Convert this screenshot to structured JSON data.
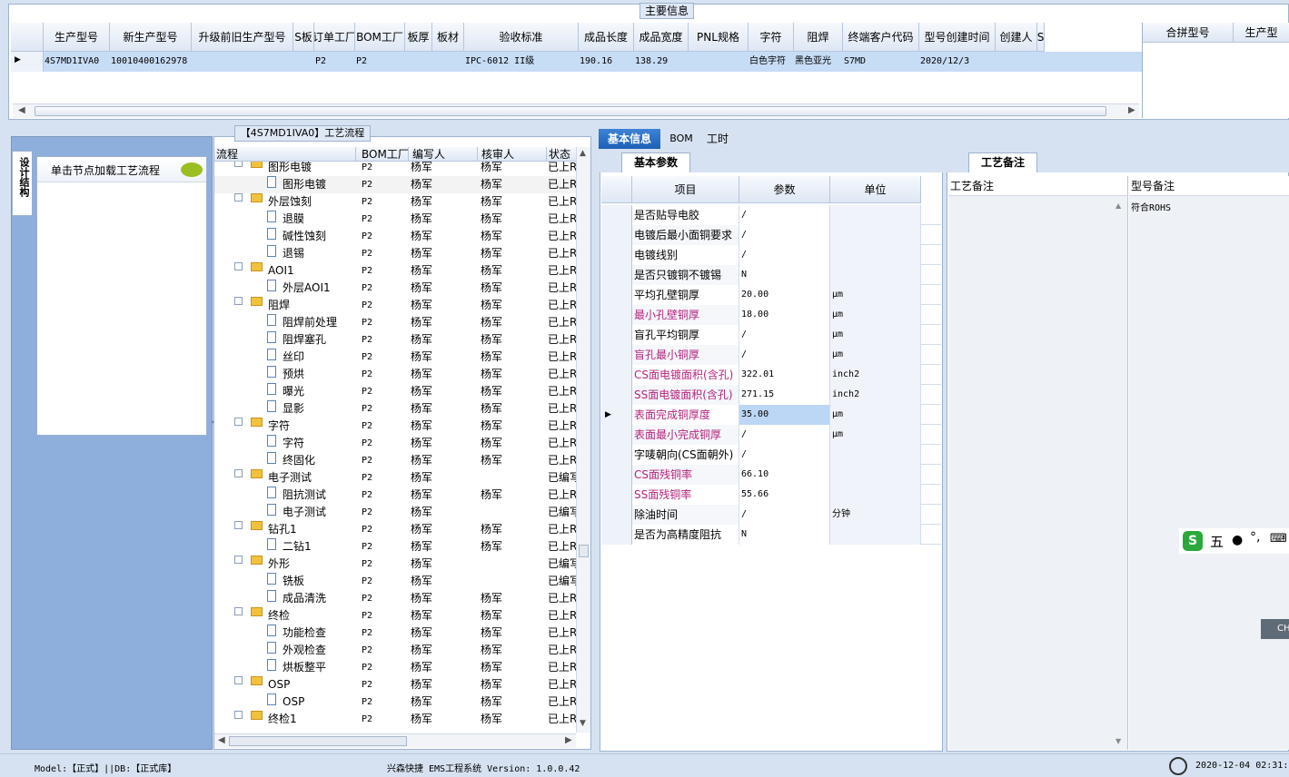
{
  "top": {
    "title": "主要信息",
    "columns": [
      "生产型号",
      "新生产型号",
      "升级前旧生产型号",
      "S板",
      "订单工厂",
      "BOM工厂",
      "板厚",
      "板材",
      "验收标准",
      "成品长度",
      "成品宽度",
      "PNL规格",
      "字符",
      "阻焊",
      "终端客户代码",
      "型号创建时间",
      "创建人",
      "S"
    ],
    "row": [
      "4S7MD1IVA0",
      "10010400162978",
      "",
      "",
      "P2",
      "P2",
      "",
      "",
      "IPC-6012 II级",
      "190.16",
      "138.29",
      "",
      "白色字符",
      "黑色亚光",
      "S7MD",
      "2020/12/3",
      "",
      ""
    ],
    "side_columns": [
      "合拼型号",
      "生产型"
    ]
  },
  "left": {
    "vertical_tab": "设计结构",
    "hint": "单击节点加载工艺流程"
  },
  "process": {
    "title": "【4S7MD1IVA0】工艺流程",
    "columns": [
      "流程",
      "BOM工厂",
      "编写人",
      "核审人",
      "状态"
    ],
    "rows": [
      {
        "name": "图形电镀",
        "folder": true,
        "f": "P2",
        "w": "杨军",
        "r": "杨军",
        "s": "已上R"
      },
      {
        "name": "图形电镀",
        "folder": false,
        "f": "P2",
        "w": "杨军",
        "r": "杨军",
        "s": "已上R"
      },
      {
        "name": "外层蚀刻",
        "folder": true,
        "f": "P2",
        "w": "杨军",
        "r": "杨军",
        "s": "已上R"
      },
      {
        "name": "退膜",
        "folder": false,
        "f": "P2",
        "w": "杨军",
        "r": "杨军",
        "s": "已上R"
      },
      {
        "name": "碱性蚀刻",
        "folder": false,
        "f": "P2",
        "w": "杨军",
        "r": "杨军",
        "s": "已上R"
      },
      {
        "name": "退锡",
        "folder": false,
        "f": "P2",
        "w": "杨军",
        "r": "杨军",
        "s": "已上R"
      },
      {
        "name": "AOI1",
        "folder": true,
        "f": "P2",
        "w": "杨军",
        "r": "杨军",
        "s": "已上R"
      },
      {
        "name": "外层AOI1",
        "folder": false,
        "f": "P2",
        "w": "杨军",
        "r": "杨军",
        "s": "已上R"
      },
      {
        "name": "阻焊",
        "folder": true,
        "f": "P2",
        "w": "杨军",
        "r": "杨军",
        "s": "已上R"
      },
      {
        "name": "阻焊前处理",
        "folder": false,
        "f": "P2",
        "w": "杨军",
        "r": "杨军",
        "s": "已上R"
      },
      {
        "name": "阻焊塞孔",
        "folder": false,
        "f": "P2",
        "w": "杨军",
        "r": "杨军",
        "s": "已上R"
      },
      {
        "name": "丝印",
        "folder": false,
        "f": "P2",
        "w": "杨军",
        "r": "杨军",
        "s": "已上R"
      },
      {
        "name": "预烘",
        "folder": false,
        "f": "P2",
        "w": "杨军",
        "r": "杨军",
        "s": "已上R"
      },
      {
        "name": "曝光",
        "folder": false,
        "f": "P2",
        "w": "杨军",
        "r": "杨军",
        "s": "已上R"
      },
      {
        "name": "显影",
        "folder": false,
        "f": "P2",
        "w": "杨军",
        "r": "杨军",
        "s": "已上R"
      },
      {
        "name": "字符",
        "folder": true,
        "f": "P2",
        "w": "杨军",
        "r": "杨军",
        "s": "已上R"
      },
      {
        "name": "字符",
        "folder": false,
        "f": "P2",
        "w": "杨军",
        "r": "杨军",
        "s": "已上R"
      },
      {
        "name": "终固化",
        "folder": false,
        "f": "P2",
        "w": "杨军",
        "r": "杨军",
        "s": "已上R"
      },
      {
        "name": "电子测试",
        "folder": true,
        "f": "P2",
        "w": "杨军",
        "r": "",
        "s": "已编写"
      },
      {
        "name": "阻抗测试",
        "folder": false,
        "f": "P2",
        "w": "杨军",
        "r": "杨军",
        "s": "已上R"
      },
      {
        "name": "电子测试",
        "folder": false,
        "f": "P2",
        "w": "杨军",
        "r": "",
        "s": "已编写"
      },
      {
        "name": "钻孔1",
        "folder": true,
        "f": "P2",
        "w": "杨军",
        "r": "杨军",
        "s": "已上R"
      },
      {
        "name": "二钻1",
        "folder": false,
        "f": "P2",
        "w": "杨军",
        "r": "杨军",
        "s": "已上R"
      },
      {
        "name": "外形",
        "folder": true,
        "f": "P2",
        "w": "杨军",
        "r": "",
        "s": "已编写"
      },
      {
        "name": "铣板",
        "folder": false,
        "f": "P2",
        "w": "杨军",
        "r": "",
        "s": "已编写"
      },
      {
        "name": "成品清洗",
        "folder": false,
        "f": "P2",
        "w": "杨军",
        "r": "杨军",
        "s": "已上R"
      },
      {
        "name": "终检",
        "folder": true,
        "f": "P2",
        "w": "杨军",
        "r": "杨军",
        "s": "已上R"
      },
      {
        "name": "功能检查",
        "folder": false,
        "f": "P2",
        "w": "杨军",
        "r": "杨军",
        "s": "已上R"
      },
      {
        "name": "外观检查",
        "folder": false,
        "f": "P2",
        "w": "杨军",
        "r": "杨军",
        "s": "已上R"
      },
      {
        "name": "烘板整平",
        "folder": false,
        "f": "P2",
        "w": "杨军",
        "r": "杨军",
        "s": "已上R"
      },
      {
        "name": "OSP",
        "folder": true,
        "f": "P2",
        "w": "杨军",
        "r": "杨军",
        "s": "已上R"
      },
      {
        "name": "OSP",
        "folder": false,
        "f": "P2",
        "w": "杨军",
        "r": "杨军",
        "s": "已上R"
      },
      {
        "name": "终检1",
        "folder": true,
        "f": "P2",
        "w": "杨军",
        "r": "杨军",
        "s": "已上R"
      }
    ]
  },
  "detail": {
    "tabs": [
      "基本信息",
      "BOM",
      "工时"
    ],
    "subtab": "基本参数",
    "columns": [
      "项目",
      "参数",
      "单位"
    ],
    "rows": [
      {
        "item": "是否贴导电胶",
        "value": "/",
        "unit": "",
        "pink": false
      },
      {
        "item": "电镀后最小面铜要求",
        "value": "/",
        "unit": "",
        "pink": false
      },
      {
        "item": "电镀线别",
        "value": "/",
        "unit": "",
        "pink": false
      },
      {
        "item": "是否只镀铜不镀锡",
        "value": "N",
        "unit": "",
        "pink": false
      },
      {
        "item": "平均孔壁铜厚",
        "value": "20.00",
        "unit": "μm",
        "pink": false
      },
      {
        "item": "最小孔壁铜厚",
        "value": "18.00",
        "unit": "μm",
        "pink": true
      },
      {
        "item": "盲孔平均铜厚",
        "value": "/",
        "unit": "μm",
        "pink": false
      },
      {
        "item": "盲孔最小铜厚",
        "value": "/",
        "unit": "μm",
        "pink": true
      },
      {
        "item": "CS面电镀面积(含孔)",
        "value": "322.01",
        "unit": "inch2",
        "pink": true
      },
      {
        "item": "SS面电镀面积(含孔)",
        "value": "271.15",
        "unit": "inch2",
        "pink": true
      },
      {
        "item": "表面完成铜厚度",
        "value": "35.00",
        "unit": "μm",
        "pink": true
      },
      {
        "item": "表面最小完成铜厚",
        "value": "/",
        "unit": "μm",
        "pink": true
      },
      {
        "item": "字唛朝向(CS面朝外)",
        "value": "/",
        "unit": "",
        "pink": false
      },
      {
        "item": "CS面残铜率",
        "value": "66.10",
        "unit": "",
        "pink": true
      },
      {
        "item": "SS面残铜率",
        "value": "55.66",
        "unit": "",
        "pink": true
      },
      {
        "item": "除油时间",
        "value": "/",
        "unit": "分钟",
        "pink": false
      },
      {
        "item": "是否为高精度阻抗",
        "value": "N",
        "unit": "",
        "pink": false
      }
    ]
  },
  "remarks": {
    "tab": "工艺备注",
    "columns": [
      "工艺备注",
      "型号备注"
    ],
    "model_note": "符合ROHS"
  },
  "ime": {
    "label": "五",
    "extra": "CH"
  },
  "status": {
    "model": "Model:【正式】||DB:【正式库】",
    "app": "兴森快捷 EMS工程系统 Version: 1.0.0.42",
    "time": "2020-12-04 02:31:"
  }
}
